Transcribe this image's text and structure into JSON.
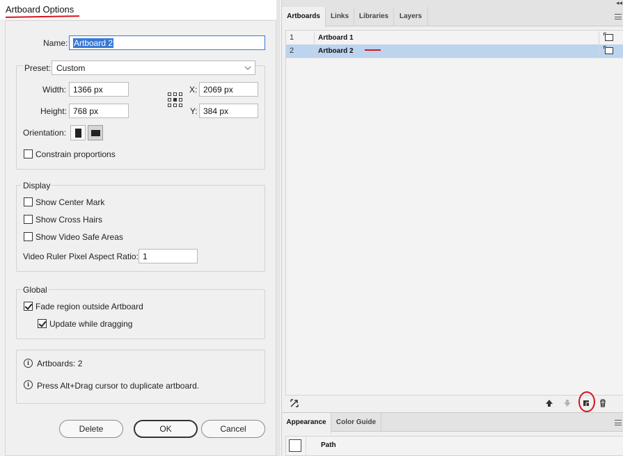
{
  "dialog": {
    "title": "Artboard Options",
    "name_label": "Name:",
    "name_value": "Artboard 2",
    "preset_label": "Preset:",
    "preset_value": "Custom",
    "width_label": "Width:",
    "width_value": "1366 px",
    "height_label": "Height:",
    "height_value": "768 px",
    "x_label": "X:",
    "x_value": "2069 px",
    "y_label": "Y:",
    "y_value": "384 px",
    "orientation_label": "Orientation:",
    "orientation_selected": "landscape",
    "constrain_label": "Constrain proportions",
    "constrain_checked": false,
    "display": {
      "title": "Display",
      "show_center_mark": "Show Center Mark",
      "show_cross_hairs": "Show Cross Hairs",
      "show_video_safe": "Show Video Safe Areas",
      "ratio_label": "Video Ruler Pixel Aspect Ratio:",
      "ratio_value": "1"
    },
    "global": {
      "title": "Global",
      "fade_label": "Fade region outside Artboard",
      "fade_checked": true,
      "update_label": "Update while dragging",
      "update_checked": true
    },
    "info": {
      "artboards_count": "Artboards: 2",
      "hint": "Press Alt+Drag cursor to duplicate artboard."
    },
    "buttons": {
      "delete": "Delete",
      "ok": "OK",
      "cancel": "Cancel"
    },
    "annotation_color": "#d5141c"
  },
  "panel": {
    "tabs": [
      "Artboards",
      "Links",
      "Libraries",
      "Layers"
    ],
    "active_tab": "Artboards",
    "rows": [
      {
        "num": "1",
        "name": "Artboard 1",
        "selected": false
      },
      {
        "num": "2",
        "name": "Artboard 2",
        "selected": true
      }
    ],
    "selection_color": "#bdd4ef",
    "footer_icons": [
      "rearrange-icon",
      "move-up-icon",
      "move-down-icon",
      "new-artboard-icon",
      "trash-icon"
    ],
    "lower_tabs": [
      "Appearance",
      "Color Guide"
    ],
    "appearance_row_label": "Path"
  }
}
